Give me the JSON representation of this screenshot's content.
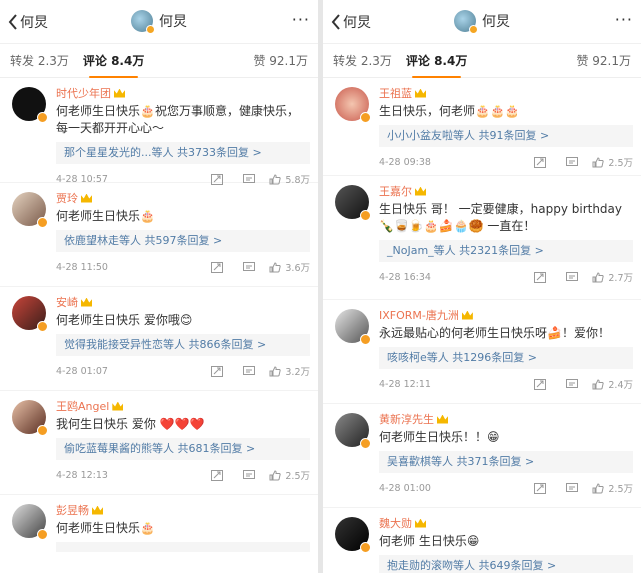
{
  "header": {
    "back_label": "何炅",
    "title": "何炅",
    "more": "···"
  },
  "tabs": {
    "repost": "转发 2.3万",
    "comments": "评论 8.4万",
    "likes": "赞 92.1万"
  },
  "left_comments": [
    {
      "name": "时代少年团",
      "text": "何老师生日快乐🎂祝您万事顺意，健康快乐，每一天都开开心心～",
      "reply": "那个星星发光的...等人  共3733条回复 >",
      "time": "4-28 10:57",
      "likes": "5.8万"
    },
    {
      "name": "贾玲",
      "text": "何老师生日快乐🎂",
      "reply": "依鹿望林走等人  共597条回复 >",
      "time": "4-28 11:50",
      "likes": "3.6万"
    },
    {
      "name": "安崎",
      "text": "何老师生日快乐 爱你哦😊",
      "reply": "觉得我能接受异性恋等人  共866条回复 >",
      "time": "4-28 01:07",
      "likes": "3.2万"
    },
    {
      "name": "王鸥Angel",
      "text": "我何生日快乐 爱你 ❤️❤️❤️",
      "reply": "偷吃蓝莓果酱的熊等人  共681条回复 >",
      "time": "4-28 12:13",
      "likes": "2.5万"
    },
    {
      "name": "彭昱畅",
      "text": "何老师生日快乐🎂",
      "reply": "",
      "time": "",
      "likes": ""
    }
  ],
  "right_comments": [
    {
      "name": "王祖蓝",
      "text": "生日快乐，何老师🎂🎂🎂",
      "reply": "小小小盆友啦等人  共91条回复 >",
      "time": "4-28 09:38",
      "likes": "2.5万"
    },
    {
      "name": "王嘉尔",
      "text": "生日快乐 哥！ 一定要健康，happy birthday 🍾🥃🍺🎂🍰🧁🥮 一直在！",
      "reply": "_NoJam_等人  共2321条回复 >",
      "time": "4-28 16:34",
      "likes": "2.7万"
    },
    {
      "name": "IXFORM-唐九洲",
      "text": "永远最贴心的何老师生日快乐呀🍰！爱你！",
      "reply": "咳咳柯e等人  共1296条回复 >",
      "time": "4-28 12:11",
      "likes": "2.4万"
    },
    {
      "name": "黄新淳先生",
      "text": "何老师生日快乐！！😁",
      "reply": "吴喜歡棋等人  共371条回复 >",
      "time": "4-28 01:00",
      "likes": "2.5万"
    },
    {
      "name": "魏大勋",
      "text": "何老师 生日快乐😁",
      "reply": "抱走勋的滚吻等人  共649条回复 >",
      "time": "",
      "likes": ""
    }
  ],
  "colors": {
    "name": "#eb7350",
    "link": "#527ca6",
    "accent": "#ff8200",
    "badge": "#f59e23"
  },
  "icons": [
    "chevron-left-icon",
    "more-icon",
    "share-icon",
    "comment-icon",
    "like-icon",
    "crown-icon",
    "verified-badge-icon"
  ]
}
